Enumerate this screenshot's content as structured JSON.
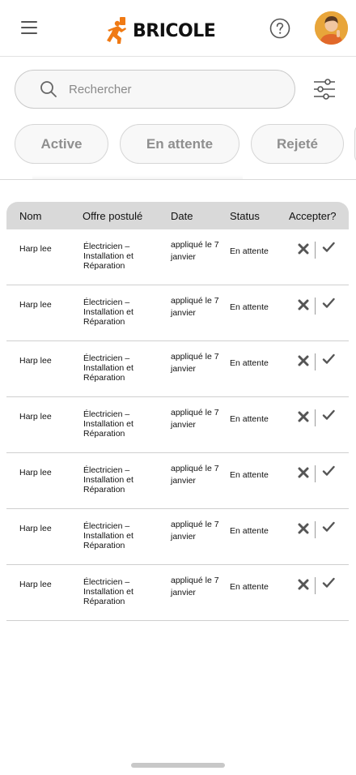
{
  "header": {
    "brand": "BRICOLE",
    "brand_color": "#F07A14"
  },
  "search": {
    "placeholder": "Rechercher"
  },
  "tabs": [
    {
      "label": "Active"
    },
    {
      "label": "En attente"
    },
    {
      "label": "Rejeté"
    }
  ],
  "table": {
    "columns": [
      "Nom",
      "Offre postulé",
      "Date",
      "Status",
      "Accepter?"
    ],
    "rows": [
      {
        "name": "Harp lee",
        "offer": "Électricien – Installation et Réparation",
        "date": "appliqué le 7 janvier",
        "status": "En attente"
      },
      {
        "name": "Harp lee",
        "offer": "Électricien – Installation et Réparation",
        "date": "appliqué le 7 janvier",
        "status": "En attente"
      },
      {
        "name": "Harp lee",
        "offer": "Électricien – Installation et Réparation",
        "date": "appliqué le 7 janvier",
        "status": "En attente"
      },
      {
        "name": "Harp lee",
        "offer": "Électricien – Installation et Réparation",
        "date": "appliqué le 7 janvier",
        "status": "En attente"
      },
      {
        "name": "Harp lee",
        "offer": "Électricien – Installation et Réparation",
        "date": "appliqué le 7 janvier",
        "status": "En attente"
      },
      {
        "name": "Harp lee",
        "offer": "Électricien – Installation et Réparation",
        "date": "appliqué le 7 janvier",
        "status": "En attente"
      },
      {
        "name": "Harp lee",
        "offer": "Électricien – Installation et Réparation",
        "date": "appliqué le 7 janvier",
        "status": "En attente"
      }
    ]
  },
  "icons": {
    "menu": "hamburger-menu-icon",
    "help": "question-circle-icon",
    "search": "magnifier-icon",
    "filter": "sliders-icon",
    "reject": "x-icon",
    "accept": "checkmark-icon"
  }
}
